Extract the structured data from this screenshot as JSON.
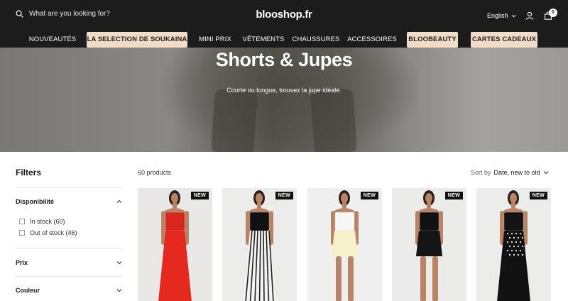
{
  "header": {
    "search_placeholder": "What are you looking for?",
    "logo": "blooshop.fr",
    "language": "English",
    "cart_count": "0"
  },
  "nav": [
    {
      "label": "NOUVEAUTÉS",
      "highlight": false
    },
    {
      "label": "LA SELECTION DE SOUKAINA",
      "highlight": true
    },
    {
      "label": "MINI PRIX",
      "highlight": false
    },
    {
      "label": "VÊTEMENTS",
      "highlight": false
    },
    {
      "label": "CHAUSSURES",
      "highlight": false
    },
    {
      "label": "ACCESSOIRES",
      "highlight": false
    },
    {
      "label": "BLOOBEAUTY",
      "highlight": true
    },
    {
      "label": "CARTES CADEAUX",
      "highlight": true
    }
  ],
  "hero": {
    "title": "Shorts & Jupes",
    "subtitle": "Courte ou longue, trouvez la jupe idéale."
  },
  "filters": {
    "title": "Filters",
    "availability": {
      "label": "Disponibilité",
      "options": [
        {
          "label": "In stock (60)"
        },
        {
          "label": "Out of stock (46)"
        }
      ]
    },
    "price": {
      "label": "Prix"
    },
    "color": {
      "label": "Couleur"
    }
  },
  "listing": {
    "count": "60 products",
    "sort_label": "Sort by",
    "sort_value": "Date, new to old"
  },
  "products": [
    {
      "badge": "NEW",
      "bg": "#e9e8e6",
      "top": "#d9261c",
      "bottom": "#e42a1f",
      "pattern": "solid"
    },
    {
      "badge": "NEW",
      "bg": "#ececeb",
      "top": "#111111",
      "bottom": "#f2f2f2",
      "pattern": "stripes"
    },
    {
      "badge": "NEW",
      "bg": "#efefef",
      "top": "#f7f7f5",
      "bottom": "#f6f1c8",
      "pattern": "solid"
    },
    {
      "badge": "NEW",
      "bg": "#ebebea",
      "top": "#121212",
      "bottom": "#151515",
      "pattern": "solid"
    },
    {
      "badge": "NEW",
      "bg": "#ececeb",
      "top": "#141414",
      "bottom": "#121212",
      "pattern": "dots"
    }
  ]
}
